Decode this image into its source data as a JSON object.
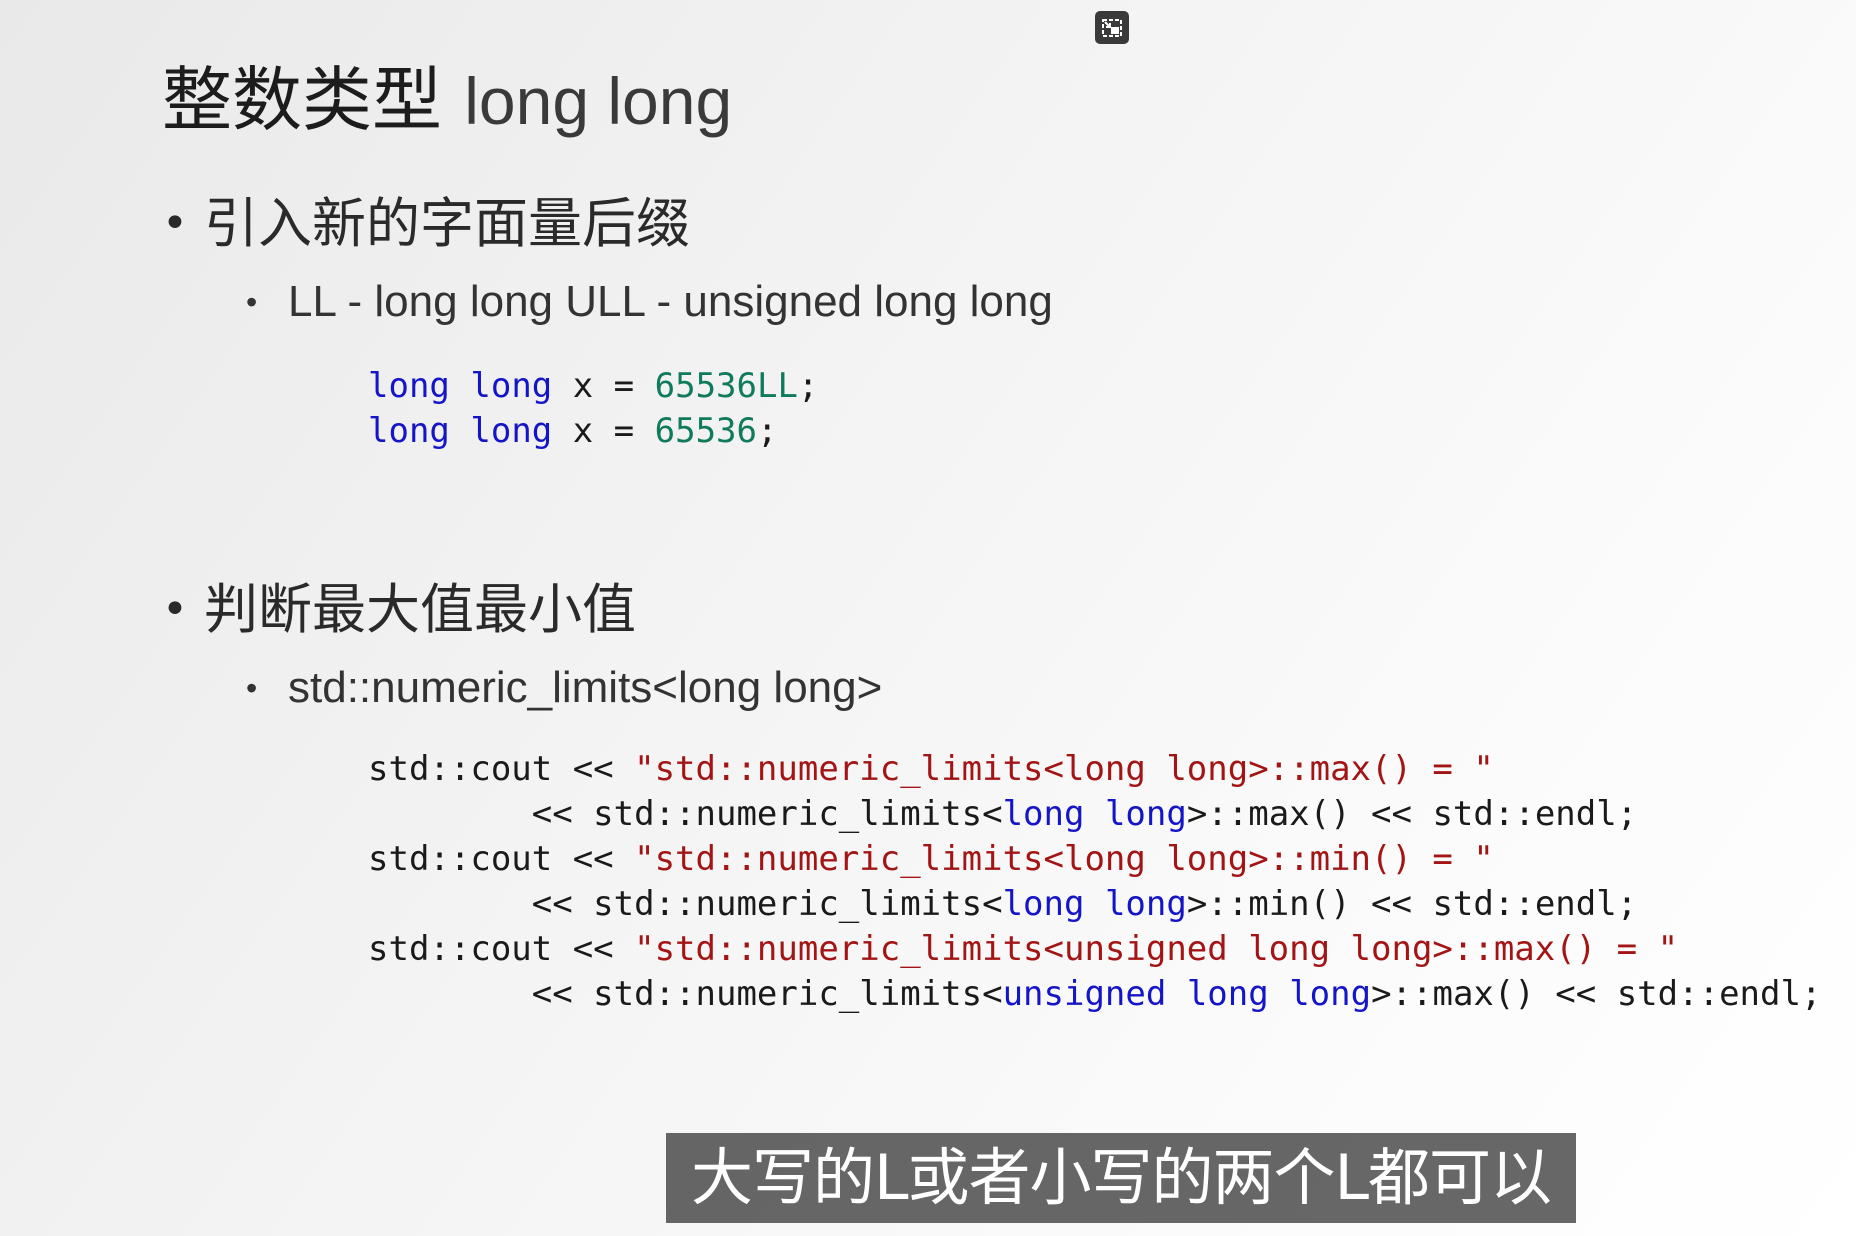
{
  "title": {
    "cjk": "整数类型",
    "latin": "long long"
  },
  "section1": {
    "heading": "引入新的字面量后缀",
    "sub": "LL - long long ULL - unsigned long long",
    "code_lines": [
      [
        {
          "t": "long",
          "c": "kw"
        },
        {
          "t": " ",
          "c": ""
        },
        {
          "t": "long",
          "c": "kw"
        },
        {
          "t": " x = ",
          "c": ""
        },
        {
          "t": "65536LL",
          "c": "num"
        },
        {
          "t": ";",
          "c": ""
        }
      ],
      [
        {
          "t": "long",
          "c": "kw"
        },
        {
          "t": " ",
          "c": ""
        },
        {
          "t": "long",
          "c": "kw"
        },
        {
          "t": " x = ",
          "c": ""
        },
        {
          "t": "65536",
          "c": "num"
        },
        {
          "t": ";",
          "c": ""
        }
      ]
    ]
  },
  "section2": {
    "heading": "判断最大值最小值",
    "sub": "std::numeric_limits<long long>",
    "code_lines": [
      [
        {
          "t": "std::cout << ",
          "c": ""
        },
        {
          "t": "\"std::numeric_limits<long long>::max() = \"",
          "c": "str"
        }
      ],
      [
        {
          "t": "        << std::numeric_limits<",
          "c": ""
        },
        {
          "t": "long",
          "c": "kw"
        },
        {
          "t": " ",
          "c": ""
        },
        {
          "t": "long",
          "c": "kw"
        },
        {
          "t": ">::max() << std::endl;",
          "c": ""
        }
      ],
      [
        {
          "t": "std::cout << ",
          "c": ""
        },
        {
          "t": "\"std::numeric_limits<long long>::min() = \"",
          "c": "str"
        }
      ],
      [
        {
          "t": "        << std::numeric_limits<",
          "c": ""
        },
        {
          "t": "long",
          "c": "kw"
        },
        {
          "t": " ",
          "c": ""
        },
        {
          "t": "long",
          "c": "kw"
        },
        {
          "t": ">::min() << std::endl;",
          "c": ""
        }
      ],
      [
        {
          "t": "std::cout << ",
          "c": ""
        },
        {
          "t": "\"std::numeric_limits<unsigned long long>::max() = \"",
          "c": "str"
        }
      ],
      [
        {
          "t": "        << std::numeric_limits<",
          "c": ""
        },
        {
          "t": "unsigned",
          "c": "kw"
        },
        {
          "t": " ",
          "c": ""
        },
        {
          "t": "long",
          "c": "kw"
        },
        {
          "t": " ",
          "c": ""
        },
        {
          "t": "long",
          "c": "kw"
        },
        {
          "t": ">::max() << std::endl;",
          "c": ""
        }
      ]
    ]
  },
  "subtitle": "大写的L或者小写的两个L都可以",
  "bullet_char": "•",
  "icons": {
    "exit": "exit-fullscreen-icon"
  },
  "colors": {
    "keyword": "#1515c8",
    "number": "#0f7a5c",
    "string": "#a31515",
    "subtitle_bg": "#3c3c3c"
  }
}
